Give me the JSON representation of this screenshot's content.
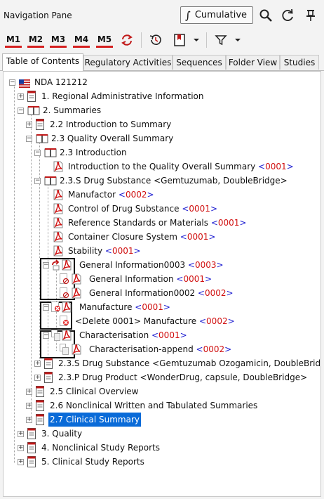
{
  "pane": {
    "title": "Navigation Pane",
    "cumulative_symbol": "∫",
    "cumulative_label": "Cumulative"
  },
  "toolbar": {
    "modules": [
      "M1",
      "M2",
      "M3",
      "M4",
      "M5"
    ]
  },
  "tabs": [
    {
      "label": "Table of Contents",
      "active": true
    },
    {
      "label": "Regulatory Activities",
      "active": false
    },
    {
      "label": "Sequences",
      "active": false
    },
    {
      "label": "Folder View",
      "active": false
    },
    {
      "label": "Studies",
      "active": false
    }
  ],
  "tree": {
    "root": "NDA 121212",
    "nodes": {
      "n1": "1. Regional Administrative Information",
      "n2": "2. Summaries",
      "n22": "2.2 Introduction to Summary",
      "n23": "2.3 Quality Overall Summary",
      "n23intro": "2.3 Introduction",
      "n_introqos": "Introduction to the Quality Overall Summary",
      "n_introqos_ver": "0001",
      "n23s": "2.3.S Drug Substance <Gemtuzumab, DoubleBridge>",
      "n_manufactor": "Manufactor",
      "n_manufactor_ver": "0002",
      "n_control": "Control of Drug Substance",
      "n_control_ver": "0001",
      "n_refstd": "Reference Standards or Materials",
      "n_refstd_ver": "0001",
      "n_container": "Container Closure System",
      "n_container_ver": "0001",
      "n_stability": "Stability",
      "n_stability_ver": "0001",
      "n_geninfo3": "General Information0003",
      "n_geninfo3_ver": "0003",
      "n_geninfo": "General Information",
      "n_geninfo_ver": "0001",
      "n_geninfo2": "General Information0002",
      "n_geninfo2_ver": "0002",
      "n_manufacture": "Manufacture",
      "n_manufacture_ver": "0001",
      "n_delmanu": "<Delete 0001> Manufacture",
      "n_delmanu_ver": "0002",
      "n_charact": "Characterisation",
      "n_charact_ver": "0001",
      "n_charapp": "Characterisation-append",
      "n_charapp_ver": "0002",
      "n23s2": "2.3.S Drug Substance <Gemtuzumab Ozogamicin, DoubleBridg",
      "n23p": "2.3.P Drug Product <WonderDrug, capsule, DoubleBridge>",
      "n25": "2.5 Clinical Overview",
      "n26": "2.6 Nonclinical Written and Tabulated Summaries",
      "n27": "2.7 Clinical Summary",
      "n3": "3. Quality",
      "n4": "4. Nonclinical Study Reports",
      "n5": "5. Clinical Study Reports"
    }
  },
  "colors": {
    "accent": "#d42020",
    "selection": "#0a6bd8",
    "version_bracket": "#1a1ad0",
    "version_number": "#d01010"
  }
}
